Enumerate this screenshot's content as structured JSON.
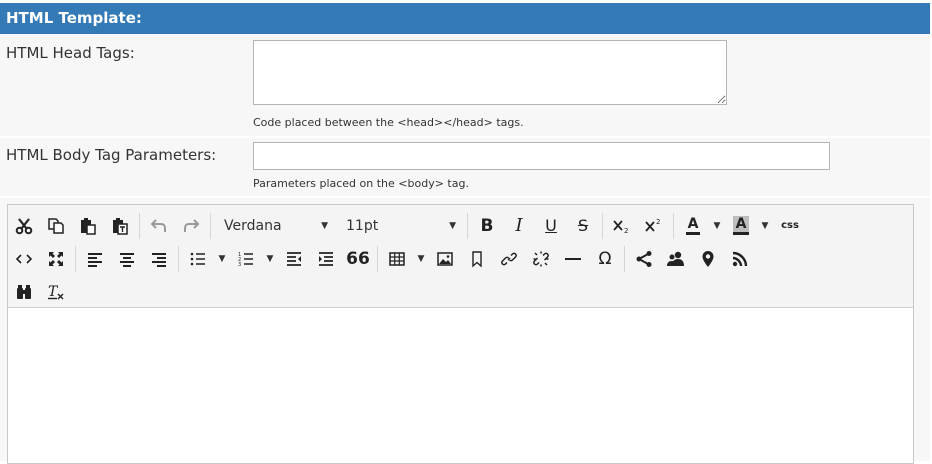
{
  "section": {
    "title": "HTML Template:"
  },
  "head_tags": {
    "label": "HTML Head Tags:",
    "value": "",
    "hint": "Code placed between the <head></head> tags."
  },
  "body_params": {
    "label": "HTML Body Tag Parameters:",
    "value": "",
    "hint": "Parameters placed on the <body> tag."
  },
  "editor": {
    "font_family": "Verdana",
    "font_size": "11pt",
    "buttons": {
      "bold": "B",
      "italic": "I",
      "underline": "U",
      "strikethrough": "S",
      "font_color": "A",
      "background_color": "A",
      "css": "css",
      "blockquote": "66",
      "special_char": "Ω"
    },
    "icons": [
      "cut-icon",
      "copy-icon",
      "paste-icon",
      "paste-text-icon",
      "undo-icon",
      "redo-icon",
      "subscript-icon",
      "superscript-icon",
      "source-code-icon",
      "fullscreen-icon",
      "align-left-icon",
      "align-center-icon",
      "align-right-icon",
      "bullet-list-icon",
      "numbered-list-icon",
      "outdent-icon",
      "indent-icon",
      "table-icon",
      "image-icon",
      "bookmark-icon",
      "link-icon",
      "unlink-icon",
      "horizontal-rule-icon",
      "share-icon",
      "users-icon",
      "map-marker-icon",
      "rss-icon",
      "find-icon",
      "clear-format-icon"
    ],
    "content": ""
  },
  "colors": {
    "header": "#337ab7",
    "row_bg": "#f7f7f7",
    "toolbar_bg": "#f4f4f4"
  }
}
